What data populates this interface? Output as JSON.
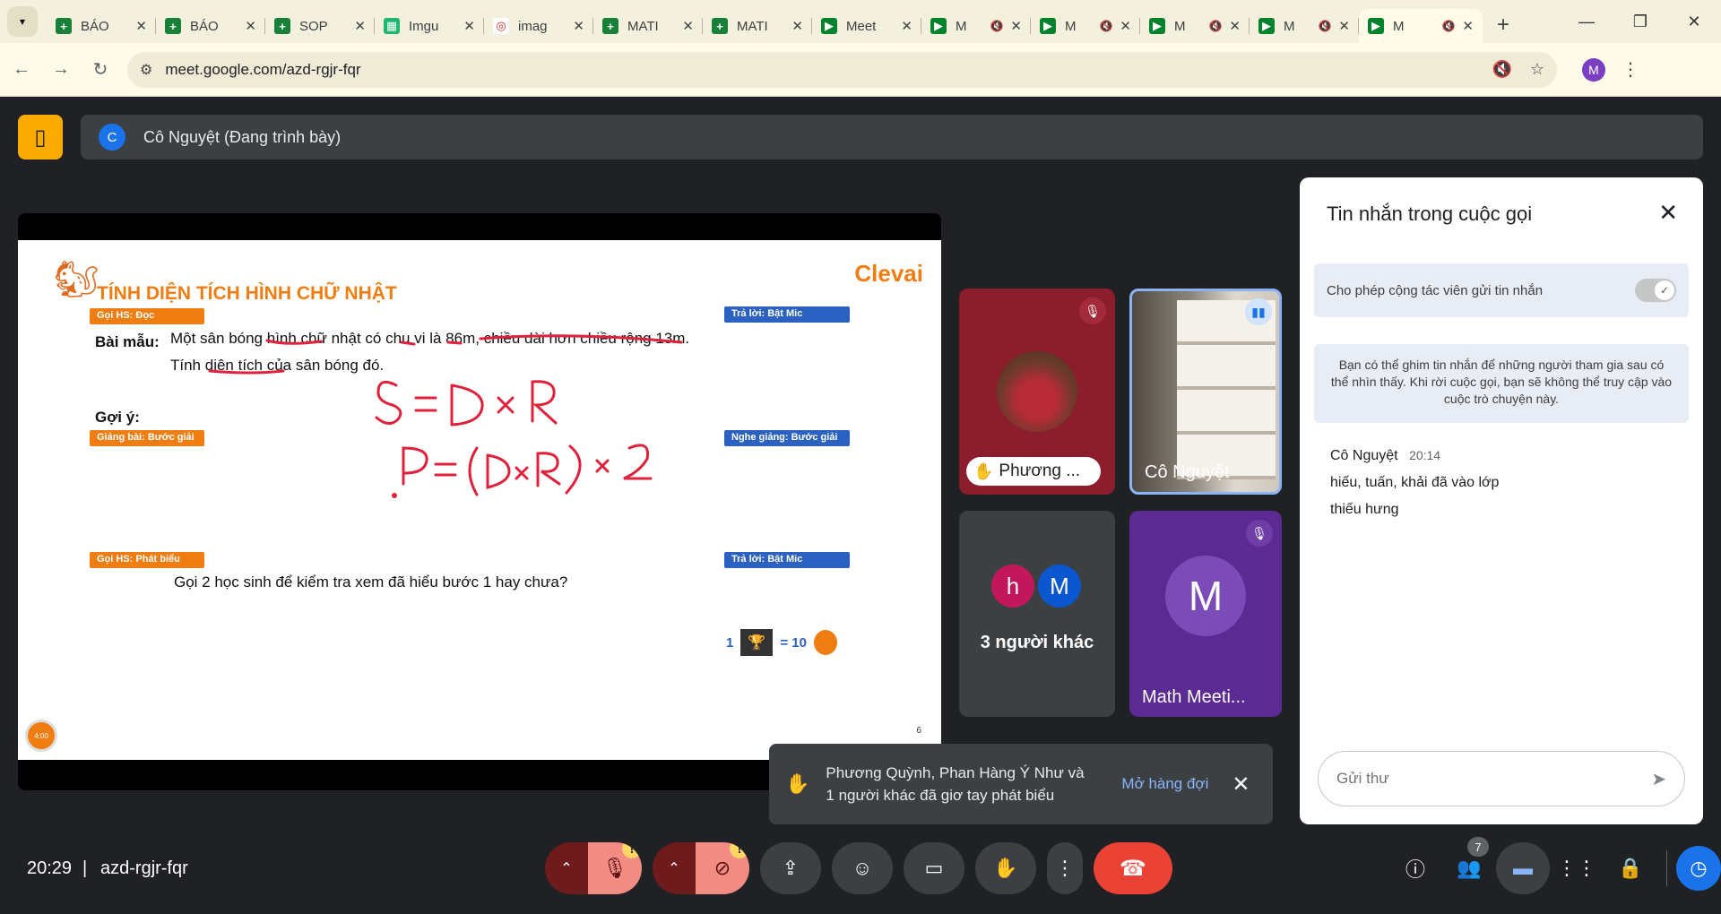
{
  "browser": {
    "tabs": [
      {
        "title": "BÁO",
        "fav_color": "#188038",
        "fav_glyph": "+",
        "muted": false
      },
      {
        "title": "BÁO",
        "fav_color": "#188038",
        "fav_glyph": "+",
        "muted": false
      },
      {
        "title": "SOP",
        "fav_color": "#188038",
        "fav_glyph": "+",
        "muted": false
      },
      {
        "title": "Imgu",
        "fav_color": "#1bb76e",
        "fav_glyph": "▦",
        "muted": false
      },
      {
        "title": "imag",
        "fav_color": "#ffffff",
        "fav_glyph": "◎",
        "muted": false
      },
      {
        "title": "MATI",
        "fav_color": "#188038",
        "fav_glyph": "+",
        "muted": false
      },
      {
        "title": "MATI",
        "fav_color": "#188038",
        "fav_glyph": "+",
        "muted": false
      },
      {
        "title": "Meet",
        "fav_color": "#00832d",
        "fav_glyph": "▶",
        "muted": false
      },
      {
        "title": "M",
        "fav_color": "#00832d",
        "fav_glyph": "▶",
        "muted": true
      },
      {
        "title": "M",
        "fav_color": "#00832d",
        "fav_glyph": "▶",
        "muted": true
      },
      {
        "title": "M",
        "fav_color": "#00832d",
        "fav_glyph": "▶",
        "muted": true
      },
      {
        "title": "M",
        "fav_color": "#00832d",
        "fav_glyph": "▶",
        "muted": true
      },
      {
        "title": "M",
        "fav_color": "#00832d",
        "fav_glyph": "▶",
        "muted": true,
        "active": true
      }
    ],
    "url": "meet.google.com/azd-rgjr-fqr",
    "profile_initial": "M"
  },
  "presenter_bar": {
    "initial": "C",
    "text": "Cô Nguyệt (Đang trình bày)"
  },
  "slide": {
    "title": "TÍNH DIỆN TÍCH HÌNH CHỮ NHẬT",
    "brand": "Clevai",
    "tag_read": "Gọi HS: Đọc",
    "tag_answer1": "Trả lời: Bật Mic",
    "example_label": "Bài mẫu:",
    "example_line1": "Một sân bóng hình chữ nhật có chu vi là 86m, chiều dài hơn chiều rộng 13m.",
    "example_line2": "Tính diện tích của sân bóng đó.",
    "hint_label": "Gợi ý:",
    "tag_teach": "Giảng bài: Bước giải",
    "tag_listen": "Nghe giảng: Bước giải",
    "tag_speak": "Gọi HS: Phát biểu",
    "tag_answer2": "Trả lời: Bật Mic",
    "question": "Gọi 2 học sinh để kiểm tra xem đã hiểu bước 1 hay chưa?",
    "score_left": "1",
    "score_right": "= 10",
    "timer": "4:00",
    "page": "6"
  },
  "tiles": {
    "t1_name": "Phương ...",
    "t2_name": "Cô Nguyệt",
    "t3_av1": "h",
    "t3_av2": "M",
    "t3_count": "3 người khác",
    "t4_initial": "M",
    "t4_name": "Math Meeti..."
  },
  "toast": {
    "message": "Phương Quỳnh, Phan Hàng Ý Như và 1 người khác đã giơ tay phát biểu",
    "action": "Mở hàng đợi"
  },
  "chat": {
    "title": "Tin nhắn trong cuộc gọi",
    "setting_label": "Cho phép cộng tác viên gửi tin nhắn",
    "info": "Bạn có thể ghim tin nhắn để những người tham gia sau có thể nhìn thấy. Khi rời cuộc gọi, bạn sẽ không thể truy cập vào cuộc trò chuyện này.",
    "sender": "Cô Nguyệt",
    "time": "20:14",
    "line1": "hiếu, tuấn, khải đã vào lớp",
    "line2": "thiếu hưng",
    "input_placeholder": "Gửi thư"
  },
  "bottom": {
    "clock": "20:29",
    "separator": "|",
    "meeting_code": "azd-rgjr-fqr",
    "people_count": "7"
  },
  "colors": {
    "accent_orange": "#f07d12",
    "accent_blue": "#2b61c1",
    "end_call": "#ea4335"
  }
}
